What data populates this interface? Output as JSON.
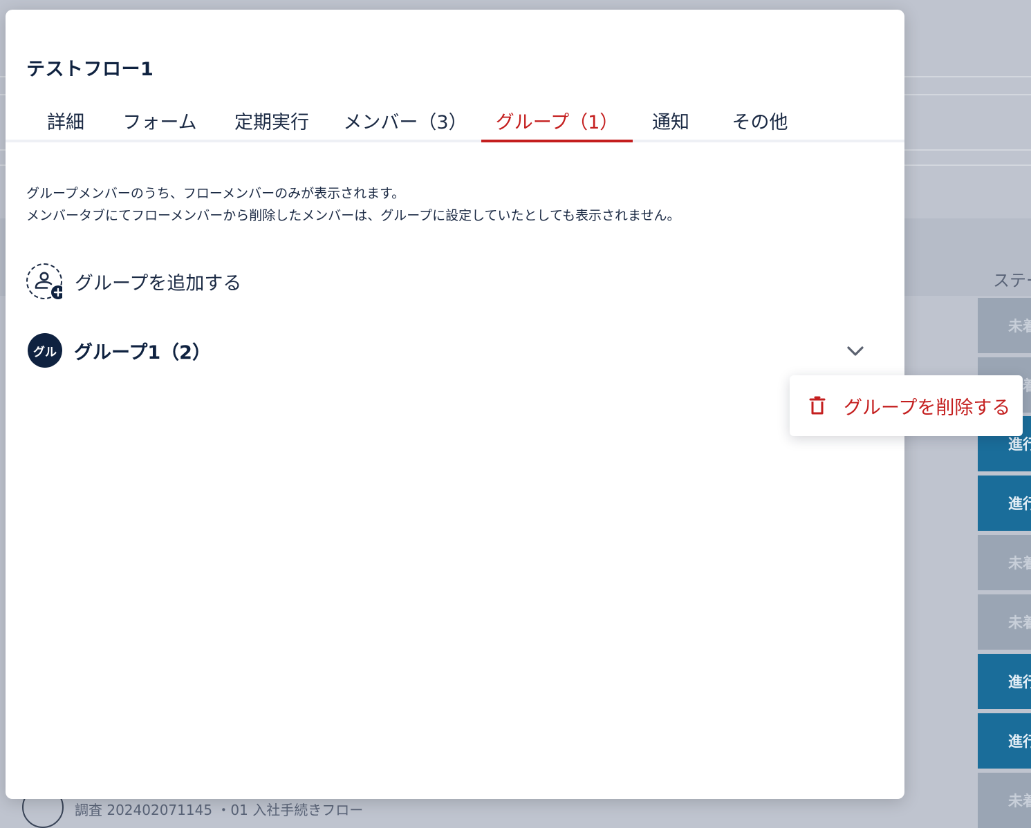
{
  "background": {
    "status_column_header": "ステー",
    "status_cells": [
      {
        "label": "未着",
        "kind": "pending"
      },
      {
        "label": "未着",
        "kind": "pending"
      },
      {
        "label": "進行",
        "kind": "progress"
      },
      {
        "label": "進行",
        "kind": "progress"
      },
      {
        "label": "未着",
        "kind": "pending"
      },
      {
        "label": "未着",
        "kind": "pending"
      },
      {
        "label": "進行",
        "kind": "progress"
      },
      {
        "label": "進行",
        "kind": "progress"
      },
      {
        "label": "未着",
        "kind": "pending"
      }
    ],
    "bottom_row_text": "調査 202402071145 ・01 入社手続きフロー"
  },
  "modal": {
    "title": "テストフロー1",
    "tabs": [
      {
        "label": "詳細"
      },
      {
        "label": "フォーム"
      },
      {
        "label": "定期実行"
      },
      {
        "label": "メンバー（3）"
      },
      {
        "label": "グループ（1）",
        "active": true
      },
      {
        "label": "通知"
      },
      {
        "label": "その他"
      }
    ],
    "description_line1": "グループメンバーのうち、フローメンバーのみが表示されます。",
    "description_line2": "メンバータブにてフローメンバーから削除したメンバーは、グループに設定していたとしても表示されません。",
    "add_group_label": "グループを追加する",
    "add_group_icon": "add-person-icon",
    "group": {
      "avatar_text": "グル",
      "name": "グループ1（2）"
    }
  },
  "menu": {
    "delete_label": "グループを削除する",
    "delete_icon": "trash-icon"
  },
  "colors": {
    "accent_red": "#c41e1e",
    "navy": "#0f2240",
    "progress_blue": "#1a6d9a",
    "pending_gray": "#9aa5b4"
  }
}
